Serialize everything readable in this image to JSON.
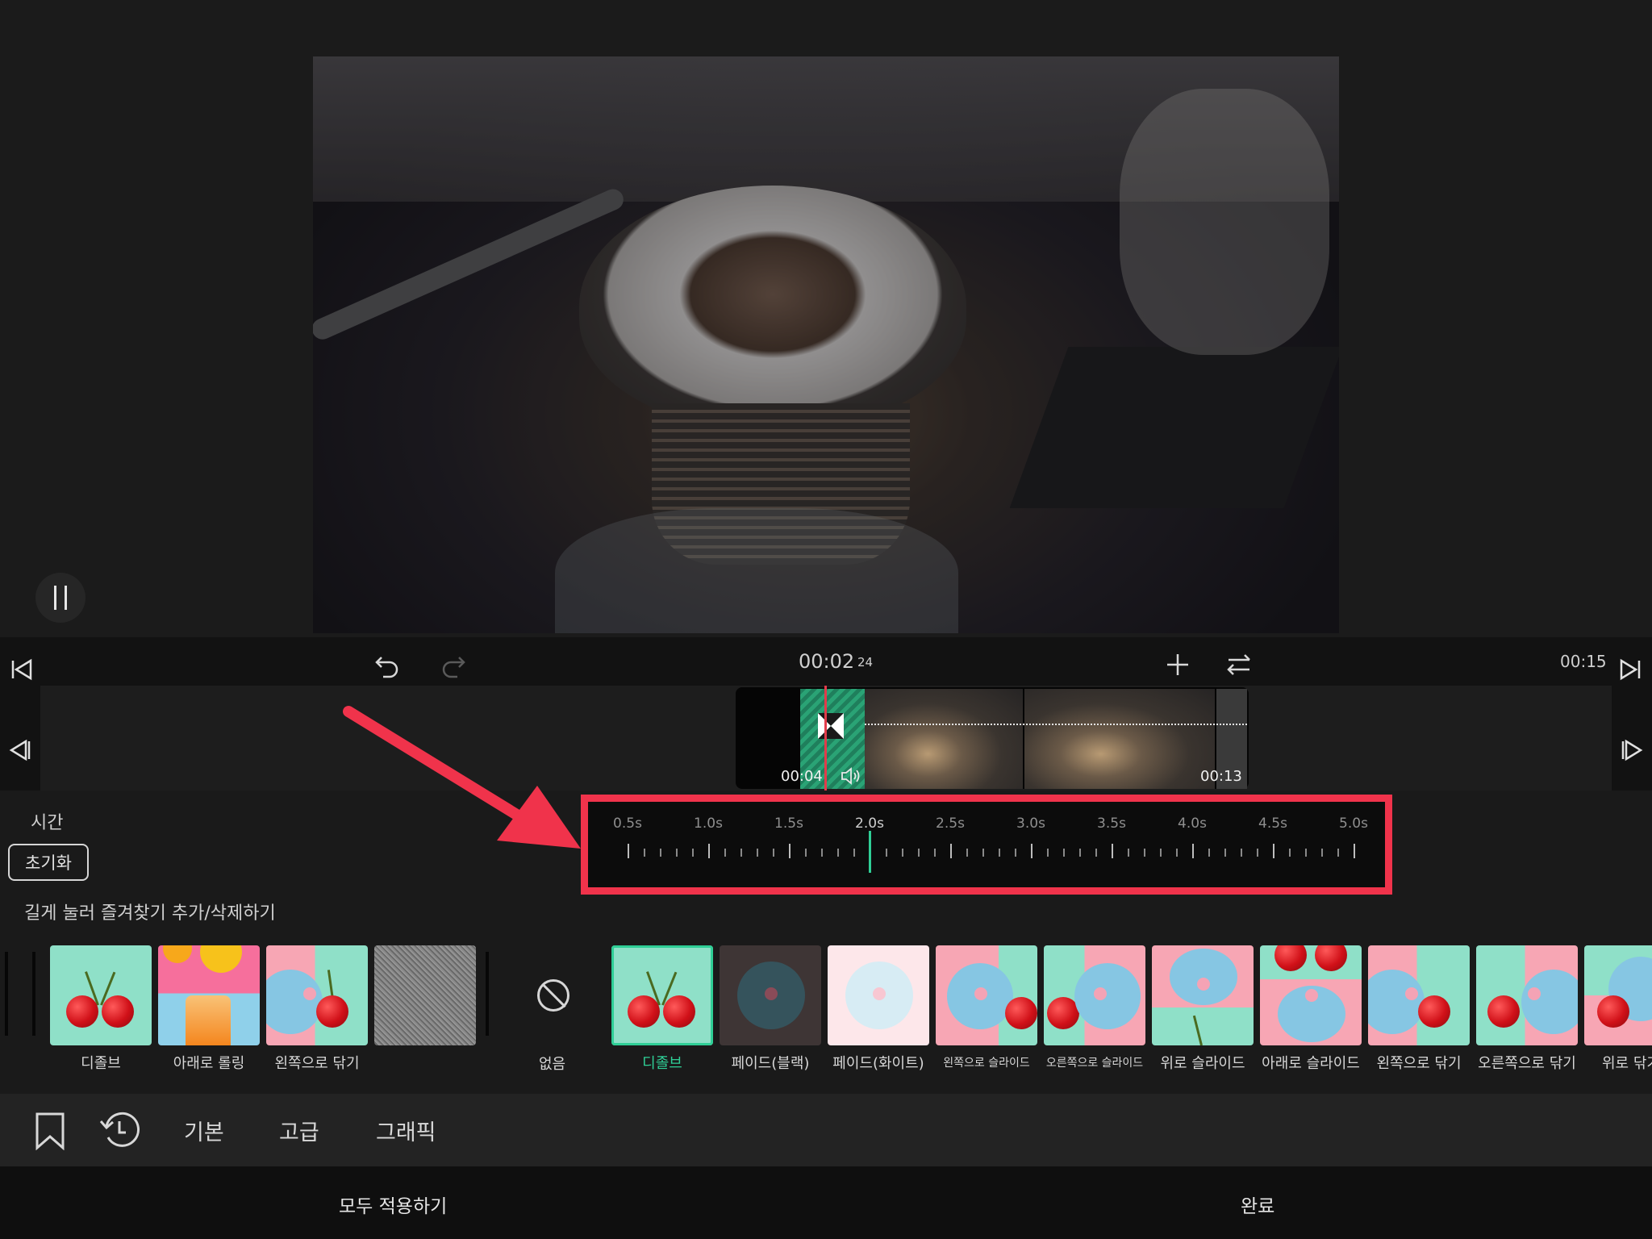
{
  "timeline": {
    "current_time": "00:02",
    "current_frame": "24",
    "total_time": "00:15",
    "clip_start_label": "00:04",
    "clip_end_label": "00:13"
  },
  "duration_ruler": {
    "labels": [
      "0.5s",
      "1.0s",
      "1.5s",
      "2.0s",
      "2.5s",
      "3.0s",
      "3.5s",
      "4.0s",
      "4.5s",
      "5.0s"
    ],
    "selected_value": "2.0s"
  },
  "panel": {
    "time_label": "시간",
    "reset_label": "초기화",
    "favorite_hint": "길게 눌러 즐겨찾기 추가/삭제하기"
  },
  "favorites": [
    {
      "label": "디졸브"
    },
    {
      "label": "아래로 롤링"
    },
    {
      "label": "왼쪽으로 닦기"
    },
    {
      "label": ""
    }
  ],
  "no_transition_label": "없음",
  "transitions": [
    {
      "label": "디졸브",
      "selected": true
    },
    {
      "label": "페이드(블랙)"
    },
    {
      "label": "페이드(화이트)"
    },
    {
      "label": "왼쪽으로 슬라이드"
    },
    {
      "label": "오른쪽으로 슬라이드"
    },
    {
      "label": "위로 슬라이드"
    },
    {
      "label": "아래로 슬라이드"
    },
    {
      "label": "왼쪽으로 닦기"
    },
    {
      "label": "오른쪽으로 닦기"
    },
    {
      "label": "위로 닦기"
    }
  ],
  "categories": [
    "기본",
    "고급",
    "그래픽"
  ],
  "bottom": {
    "apply_all": "모두 적용하기",
    "done": "완료"
  },
  "colors": {
    "accent": "#2fcf96",
    "highlight_box": "#f0334b",
    "playhead": "#e23b4a"
  }
}
